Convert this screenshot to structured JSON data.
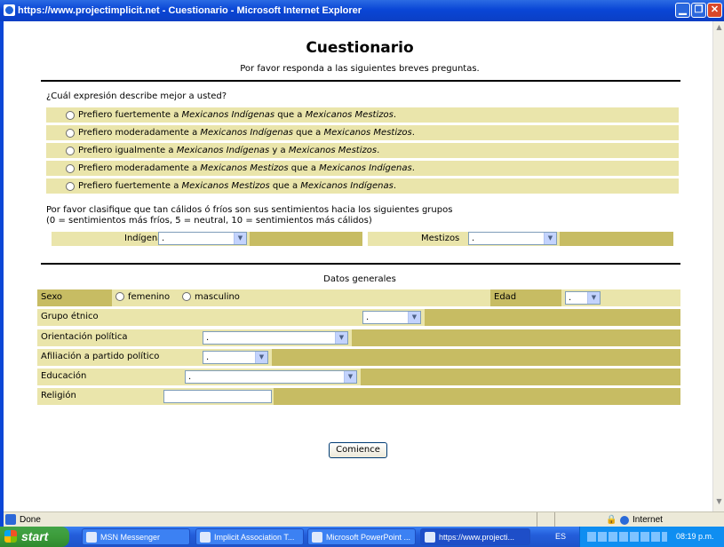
{
  "window": {
    "title": "https://www.projectimplicit.net - Cuestionario - Microsoft Internet Explorer"
  },
  "page": {
    "title": "Cuestionario",
    "subtitle": "Por favor responda a las siguientes breves preguntas."
  },
  "q1": {
    "question": "¿Cuál expresión describe mejor a usted?",
    "options": [
      {
        "pre": "Prefiero fuertemente a ",
        "a": "Mexicanos Indígenas",
        "mid": " que a ",
        "b": "Mexicanos Mestizos",
        "post": "."
      },
      {
        "pre": "Prefiero moderadamente a ",
        "a": "Mexicanos Indígenas",
        "mid": " que a ",
        "b": "Mexicanos Mestizos",
        "post": "."
      },
      {
        "pre": "Prefiero igualmente a ",
        "a": "Mexicanos Indígenas",
        "mid": " y a ",
        "b": "Mexicanos Mestizos",
        "post": "."
      },
      {
        "pre": "Prefiero moderadamente a ",
        "a": "Mexicanos Mestizos",
        "mid": " que a ",
        "b": "Mexicanos Indígenas",
        "post": "."
      },
      {
        "pre": "Prefiero fuertemente a ",
        "a": "Mexicanos Mestizos",
        "mid": " que a ",
        "b": "Mexicanos Indígenas",
        "post": "."
      }
    ]
  },
  "q2": {
    "line1": "Por favor clasifique que tan cálidos ó fríos son sus sentimientos hacia los siguientes grupos",
    "line2": "(0 = sentimientos más fríos, 5 = neutral, 10 = sentimientos más cálidos)",
    "indigenas_label": "Indígenas",
    "indigenas_value": ".",
    "mestizos_label": "Mestizos",
    "mestizos_value": "."
  },
  "general": {
    "title": "Datos generales",
    "sexo_label": "Sexo",
    "femenino": "femenino",
    "masculino": "masculino",
    "edad_label": "Edad",
    "edad_value": ".",
    "grupo_label": "Grupo étnico",
    "grupo_value": ".",
    "orientacion_label": "Orientación política",
    "orientacion_value": ".",
    "afiliacion_label": "Afiliación a partido político",
    "afiliacion_value": ".",
    "educacion_label": "Educación",
    "educacion_value": ".",
    "religion_label": "Religión",
    "religion_value": ""
  },
  "submit_label": "Comience",
  "statusbar": {
    "left": "Done",
    "zone": "Internet"
  },
  "taskbar": {
    "start": "start",
    "tasks": [
      "MSN Messenger",
      "Implicit Association T...",
      "Microsoft PowerPoint ...",
      "https://www.projecti..."
    ],
    "lang": "ES",
    "clock": "08:19 p.m."
  },
  "colors": {
    "option_band": "#eae5ab",
    "general_band": "#c7bc63",
    "titlebar": "#0a46d6"
  }
}
